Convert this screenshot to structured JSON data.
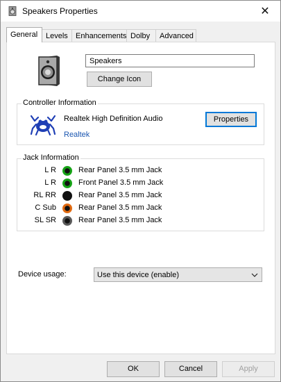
{
  "window": {
    "title": "Speakers Properties"
  },
  "tabs": [
    {
      "label": "General"
    },
    {
      "label": "Levels"
    },
    {
      "label": "Enhancements"
    },
    {
      "label": "Dolby"
    },
    {
      "label": "Advanced"
    }
  ],
  "device": {
    "name": "Speakers",
    "change_icon_label": "Change Icon"
  },
  "controller": {
    "title": "Controller Information",
    "name": "Realtek High Definition Audio",
    "vendor": "Realtek",
    "properties_label": "Properties"
  },
  "jack": {
    "title": "Jack Information",
    "rows": [
      {
        "channel": "L R",
        "label": "Rear Panel 3.5 mm Jack",
        "color": "#17a317"
      },
      {
        "channel": "L R",
        "label": "Front Panel 3.5 mm Jack",
        "color": "#17a317"
      },
      {
        "channel": "RL RR",
        "label": "Rear Panel 3.5 mm Jack",
        "color": "#111111"
      },
      {
        "channel": "C Sub",
        "label": "Rear Panel 3.5 mm Jack",
        "color": "#e06a12"
      },
      {
        "channel": "SL SR",
        "label": "Rear Panel 3.5 mm Jack",
        "color": "#5a5a5a"
      }
    ]
  },
  "usage": {
    "label": "Device usage:",
    "value": "Use this device (enable)"
  },
  "buttons": {
    "ok": "OK",
    "cancel": "Cancel",
    "apply": "Apply"
  },
  "colors": {
    "focus": "#0078d7",
    "link": "#1a56b0",
    "accent_green": "#17a317"
  }
}
